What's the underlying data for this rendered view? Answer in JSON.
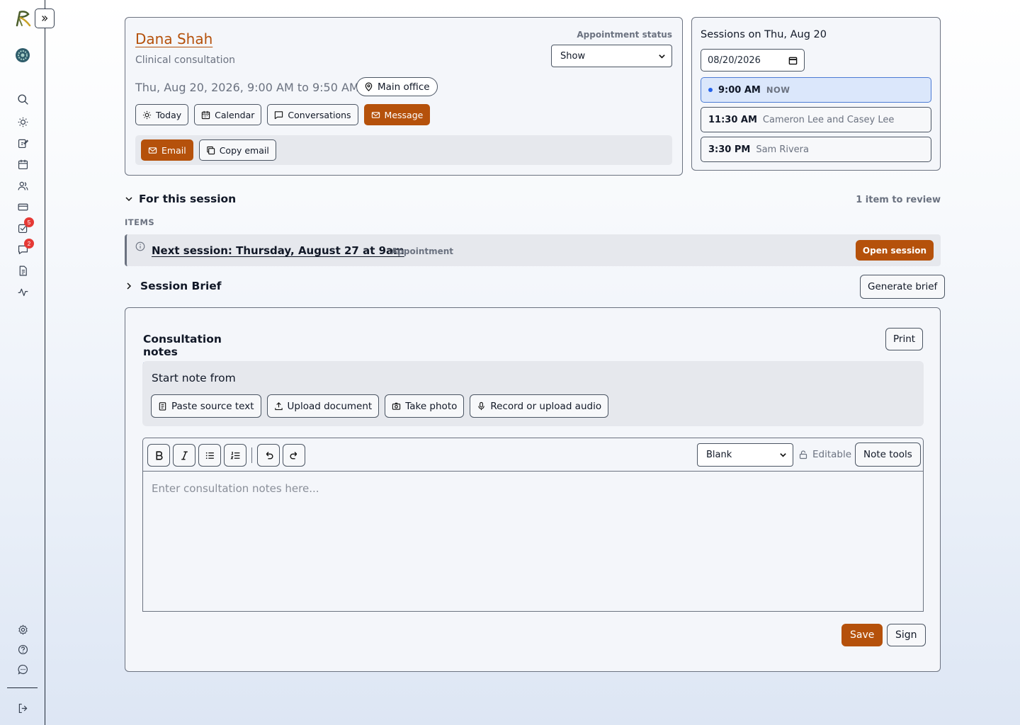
{
  "sidebar": {
    "badges": {
      "tasks": "5",
      "messages": "2"
    }
  },
  "appointment": {
    "client_name": "Dana Shah",
    "type": "Clinical consultation",
    "status_label": "Appointment status",
    "status_value": "Show",
    "datetime": "Thu, Aug 20, 2026, 9:00 AM to 9:50 AM",
    "location": "Main office",
    "actions": {
      "today": "Today",
      "calendar": "Calendar",
      "conversations": "Conversations",
      "message": "Message"
    },
    "email_actions": {
      "email": "Email",
      "copy_email": "Copy email"
    }
  },
  "sessions": {
    "title": "Sessions on Thu, Aug 20",
    "date_value": "08/20/2026",
    "items": [
      {
        "time": "9:00 AM",
        "who": "NOW"
      },
      {
        "time": "11:30 AM",
        "who": "Cameron Lee and Casey Lee"
      },
      {
        "time": "3:30 PM",
        "who": "Sam Rivera"
      }
    ]
  },
  "for_session": {
    "title": "For this session",
    "review_count": "1 item to review",
    "items_label": "ITEMS",
    "item": {
      "title": "Next session: Thursday, August 27 at 9am",
      "kind": "Appointment",
      "action": "Open session"
    }
  },
  "brief": {
    "title": "Session Brief",
    "action": "Generate brief"
  },
  "notes": {
    "tab": "Consultation notes",
    "print": "Print",
    "start_from": {
      "title": "Start note from",
      "paste": "Paste source text",
      "upload": "Upload document",
      "photo": "Take photo",
      "audio": "Record or upload audio"
    },
    "template_value": "Blank",
    "editable": "Editable",
    "note_tools": "Note tools",
    "placeholder": "Enter consultation notes here...",
    "save": "Save",
    "sign": "Sign"
  },
  "colors": {
    "accent": "#b5510b",
    "now_highlight": "#dbe7fb",
    "badge": "#e53935"
  }
}
